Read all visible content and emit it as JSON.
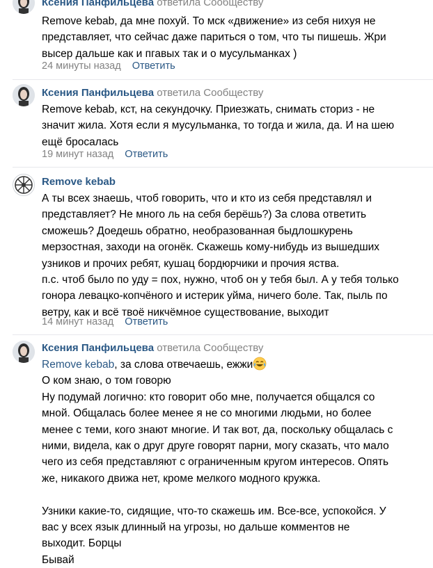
{
  "comments": [
    {
      "author": "Ксения Панфильцева",
      "replied": "ответила Сообществу",
      "lines": [
        "Remove kebab, да мне похуй. То мск «движение» из себя нихуя не",
        "представляет, что сейчас даже париться о том, что ты пишешь. Жри",
        "высер дальше как и пгавых так и о мусульманках )"
      ],
      "time": "24 минуты назад",
      "reply": "Ответить"
    },
    {
      "author": "Ксения Панфильцева",
      "replied": "ответила Сообществу",
      "lines": [
        "Remove kebab, кст, на секундочку. Приезжать, снимать сториз - не",
        "значит жила. Хотя если я мусульманка, то тогда и жила, да. И на шею",
        "ещё бросалась"
      ],
      "time": "19 минут назад",
      "reply": "Ответить"
    },
    {
      "author": "Remove kebab",
      "replied": "",
      "lines": [
        "А ты всех знаешь, чтоб говорить, что и кто из себя представлял и",
        "представляет? Не много ль на себя берёшь?) За слова ответить",
        "сможешь? Доедешь обратно, необразованная быдлошкурень",
        "мерзостная, заходи на огонёк. Скажешь кому-нибудь из вышедших",
        "узников и прочих ребят, кушац бордюрчики и прочия яства.",
        "п.с. чтоб было по уду = пох, нужно, чтоб он у тебя был. А у тебя только",
        "гонора левацко-копчёного и истерик уйма, ничего боле. Так, пыль по",
        "ветру, как и всё твоё никчёмное существование, выходит"
      ],
      "time": "14 минут назад",
      "reply": "Ответить"
    },
    {
      "author": "Ксения Панфильцева",
      "replied": "ответила Сообществу",
      "mention": "Remove kebab",
      "first_line_rest": ", за слова отвечаешь, ежжи",
      "lines": [
        "О ком знаю, о том говорю",
        "Ну подумай логично: кто говорит обо мне, получается общался со",
        "мной. Общалась более менее я не со многими людьми, но более",
        "менее с теми, кого знают многие. И так вот, да, поскольку общалась с",
        "ними, видела, как о друг друге говорят парни, могу сказать, что мало",
        "чего из себя представляют с ограниченным кругом интересов. Опять",
        "же, никакого движа нет, кроме мелкого модного кружка.",
        "",
        "Узники какие-то, сидящие, что-то скажешь им. Все-все, успокойся. У",
        "вас у всех язык длинный на угрозы, но дальше комментов не",
        "выходит. Борцы",
        "Бывай"
      ]
    }
  ],
  "icons": {
    "laugh_emoji": "tears-of-joy-emoji"
  },
  "colors": {
    "link": "#2a5885",
    "muted": "#828282",
    "divider": "#e7e8ec"
  }
}
